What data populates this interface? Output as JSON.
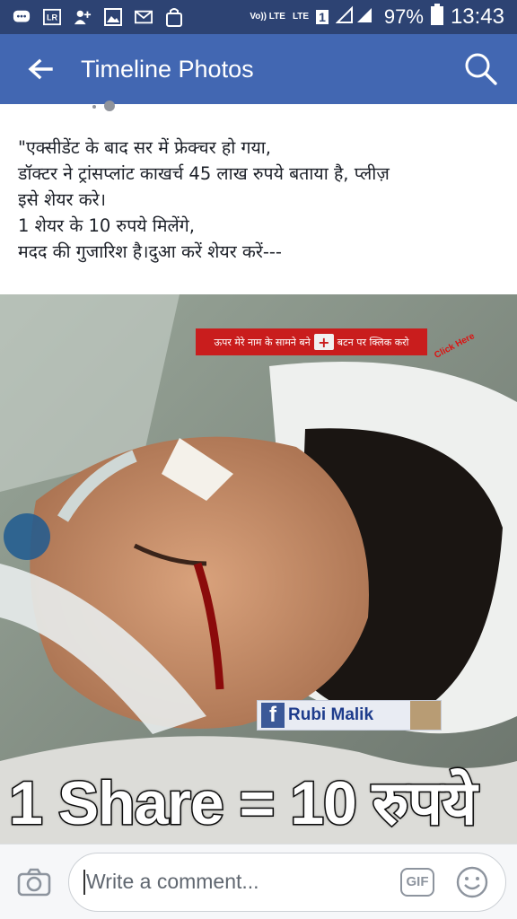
{
  "status_bar": {
    "carrier_icon": "LR",
    "volte": "Vo)) LTE",
    "lte": "LTE",
    "sim": "1",
    "battery": "97%",
    "time": "13:43",
    "icons": [
      "chat-icon",
      "lr-icon",
      "add-person-icon",
      "gallery-icon",
      "mail-icon",
      "bag-icon"
    ]
  },
  "app_bar": {
    "title": "Timeline Photos",
    "back_icon": "arrow-left-icon",
    "search_icon": "search-icon"
  },
  "post": {
    "lines": [
      "\"एक्सीडेंट के बाद सर में फ्रेक्चर हो गया,",
      "डॉक्टर ने ट्रांसप्लांट काखर्च 45 लाख रुपये बताया है, प्लीज़",
      "इसे शेयर करे।",
      "1 शेयर के 10 रुपये मिलेंगे,",
      "मदद की गुजारिश है।दुआ करें शेयर करें---"
    ]
  },
  "photo": {
    "banner_left": "ऊपर मेरे नाम के सामने बने",
    "banner_plus": "+",
    "banner_right": "बटन पर क्लिक करो",
    "click_here": "Click Here",
    "fb_letter": "f",
    "fb_name": "Rubi Malik",
    "share_caption": "1 Share = 10 रुपये"
  },
  "comment_bar": {
    "placeholder": "Write a comment...",
    "gif_label": "GIF",
    "camera_icon": "camera-icon",
    "emoji_icon": "smiley-icon"
  },
  "colors": {
    "status_bar": "#2d4373",
    "app_bar": "#4267b2",
    "banner": "#c91d1d"
  }
}
